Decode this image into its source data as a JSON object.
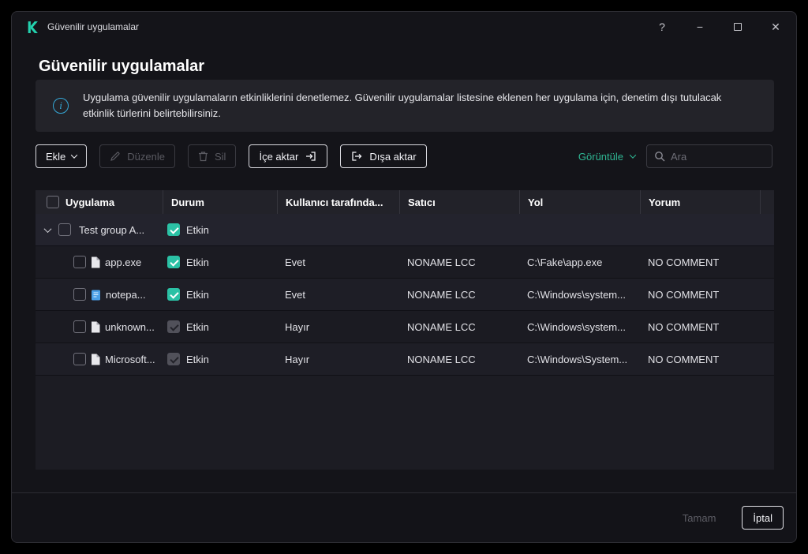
{
  "colors": {
    "accent": "#2bc1a5",
    "logo_green": "#23d1ae",
    "info_blue": "#35a9d8"
  },
  "window": {
    "title": "Güvenilir uygulamalar",
    "controls": {
      "help": "?",
      "minimize": "−",
      "close": "✕"
    }
  },
  "page": {
    "title": "Güvenilir uygulamalar"
  },
  "banner": {
    "text": "Uygulama güvenilir uygulamaların etkinliklerini denetlemez. Güvenilir uygulamalar listesine eklenen her uygulama için, denetim dışı tutulacak etkinlik türlerini belirtebilirsiniz."
  },
  "toolbar": {
    "add": "Ekle",
    "edit": "Düzenle",
    "delete": "Sil",
    "import": "İçe aktar",
    "export": "Dışa aktar",
    "view": "Görüntüle",
    "search_placeholder": "Ara"
  },
  "table": {
    "columns": [
      "Uygulama",
      "Durum",
      "Kullanıcı tarafında...",
      "Satıcı",
      "Yol",
      "Yorum"
    ],
    "group": {
      "name": "Test group A...",
      "status": "Etkin",
      "status_checked": true,
      "status_locked": false
    },
    "rows": [
      {
        "icon": "file-icon",
        "name": "app.exe",
        "status": "Etkin",
        "status_checked": true,
        "status_locked": false,
        "user_defined": "Evet",
        "vendor": "NONAME LCC",
        "path": "C:\\Fake\\app.exe",
        "comment": "NO COMMENT"
      },
      {
        "icon": "notepad-icon",
        "name": "notepa...",
        "status": "Etkin",
        "status_checked": true,
        "status_locked": false,
        "user_defined": "Evet",
        "vendor": "NONAME LCC",
        "path": "C:\\Windows\\system...",
        "comment": "NO COMMENT"
      },
      {
        "icon": "file-icon",
        "name": "unknown...",
        "status": "Etkin",
        "status_checked": true,
        "status_locked": true,
        "user_defined": "Hayır",
        "vendor": "NONAME LCC",
        "path": "C:\\Windows\\system...",
        "comment": "NO COMMENT"
      },
      {
        "icon": "file-icon",
        "name": "Microsoft...",
        "status": "Etkin",
        "status_checked": true,
        "status_locked": true,
        "user_defined": "Hayır",
        "vendor": "NONAME LCC",
        "path": "C:\\Windows\\System...",
        "comment": "NO COMMENT"
      }
    ]
  },
  "footer": {
    "ok": "Tamam",
    "cancel": "İptal"
  }
}
